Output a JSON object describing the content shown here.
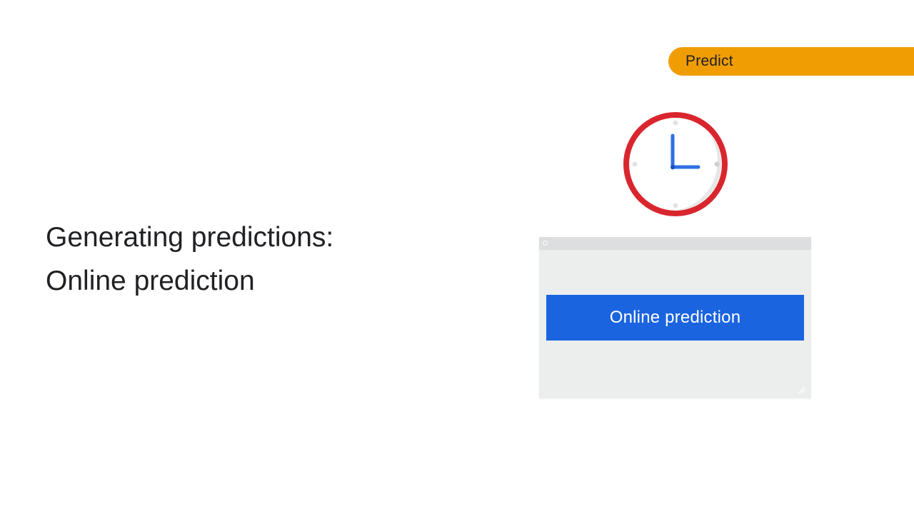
{
  "tag": {
    "label": "Predict",
    "color": "#f09d04"
  },
  "title": {
    "line1": "Generating predictions:",
    "line2": "Online prediction"
  },
  "illustration": {
    "clock_icon": "clock-icon",
    "clock_ring_color": "#d9262e",
    "clock_hand_color": "#2f6fe4"
  },
  "window": {
    "button_label": "Online prediction",
    "button_color": "#1a64e0"
  }
}
